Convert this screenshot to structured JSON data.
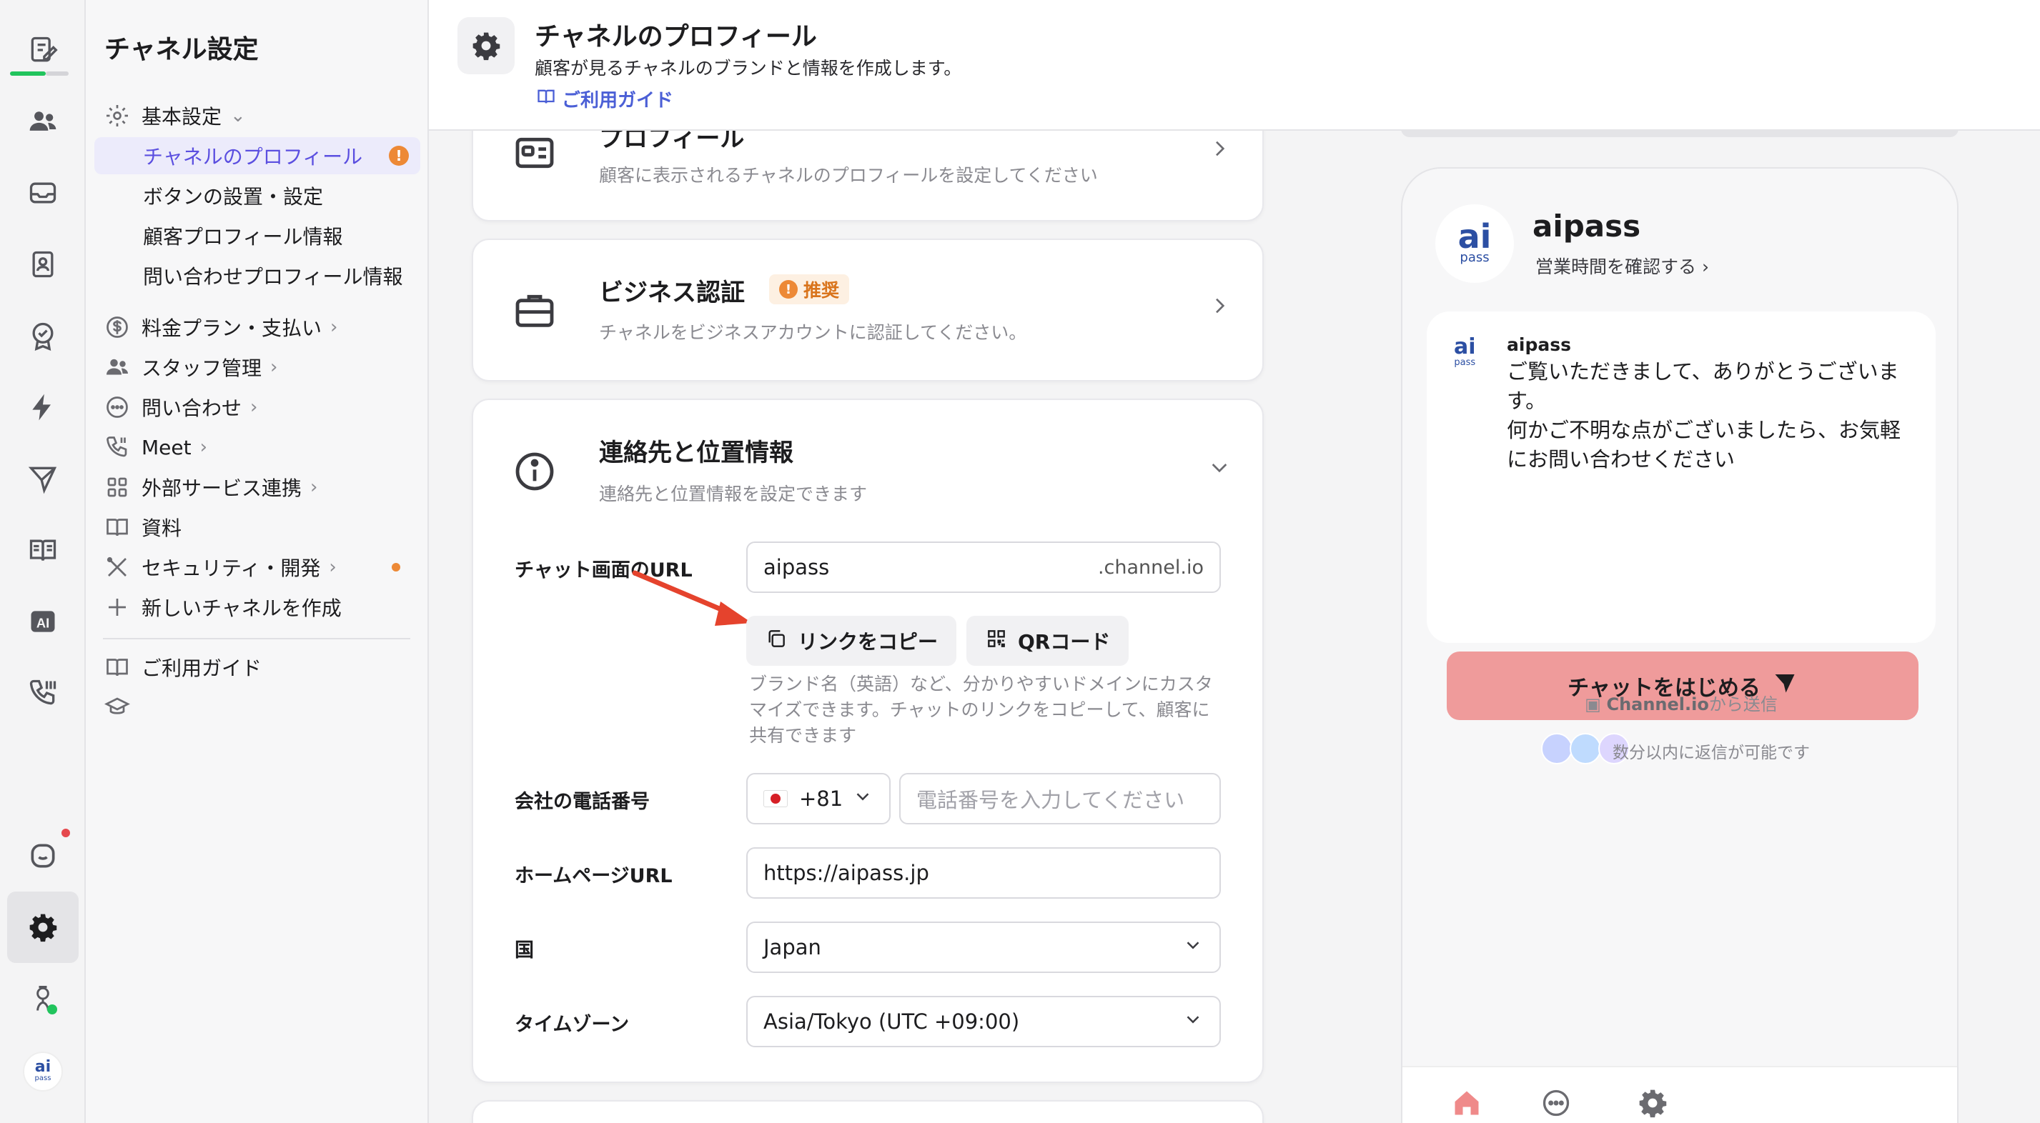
{
  "header": {
    "title": "チャネルのプロフィール",
    "description": "顧客が見るチャネルのブランドと情報を作成します。",
    "guide_link": "ご利用ガイド"
  },
  "sidebar": {
    "title": "チャネル設定",
    "sections": [
      {
        "label": "基本設定",
        "chevron": "⌄"
      },
      {
        "label": "料金プラン・支払い",
        "chevron": "›"
      },
      {
        "label": "スタッフ管理",
        "chevron": "›"
      },
      {
        "label": "問い合わせ",
        "chevron": "›"
      },
      {
        "label": "Meet",
        "chevron": "›"
      },
      {
        "label": "外部サービス連携",
        "chevron": "›"
      },
      {
        "label": "資料"
      },
      {
        "label": "セキュリティ・開発",
        "chevron": "›"
      },
      {
        "label": "新しいチャネルを作成"
      },
      {
        "label": "ご利用ガイド"
      }
    ],
    "sub_items": [
      {
        "label": "チャネルのプロフィール",
        "badge": "!"
      },
      {
        "label": "ボタンの設置・設定"
      },
      {
        "label": "顧客プロフィール情報"
      },
      {
        "label": "問い合わせプロフィール情報"
      }
    ]
  },
  "cards": {
    "profile": {
      "title": "プロフィール",
      "description": "顧客に表示されるチャネルのプロフィールを設定してください"
    },
    "business": {
      "title": "ビジネス認証",
      "badge": "推奨",
      "description": "チャネルをビジネスアカウントに認証してください。"
    },
    "contact": {
      "title": "連絡先と位置情報",
      "description": "連絡先と位置情報を設定できます"
    }
  },
  "form": {
    "chat_url_label": "チャット画面のURL",
    "chat_url_value": "aipass",
    "chat_url_suffix": ".channel.io",
    "copy_link_button": "リンクをコピー",
    "qr_button": "QRコード",
    "help_text": "ブランド名（英語）など、分かりやすいドメインにカスタマイズできます。チャットのリンクをコピーして、顧客に共有できます",
    "phone_label": "会社の電話番号",
    "phone_country_code": "+81",
    "phone_placeholder": "電話番号を入力してください",
    "homepage_label": "ホームページURL",
    "homepage_value": "https://aipass.jp",
    "country_label": "国",
    "country_value": "Japan",
    "timezone_label": "タイムゾーン",
    "timezone_value": "Asia/Tokyo (UTC +09:00)"
  },
  "preview": {
    "logo_text": "ai",
    "logo_sub": "pass",
    "channel_name": "aipass",
    "hours_link": "営業時間を確認する ›",
    "message_sender": "aipass",
    "message_text": "ご覧いただきまして、ありがとうございます。\n何かご不明な点がございましたら、お気軽にお問い合わせください",
    "start_chat_button": "チャットをはじめる",
    "reply_time": "数分以内に返信が可能です",
    "powered_brand": "Channel.io",
    "powered_suffix": "から送信"
  },
  "colors": {
    "accent": "#5b4fe0",
    "active_bg": "#ecebfb",
    "warning": "#ed8936",
    "chat_button": "#ef9b9b",
    "online": "#21c45d",
    "notification": "#e5484d",
    "arrow": "#e5432d"
  }
}
